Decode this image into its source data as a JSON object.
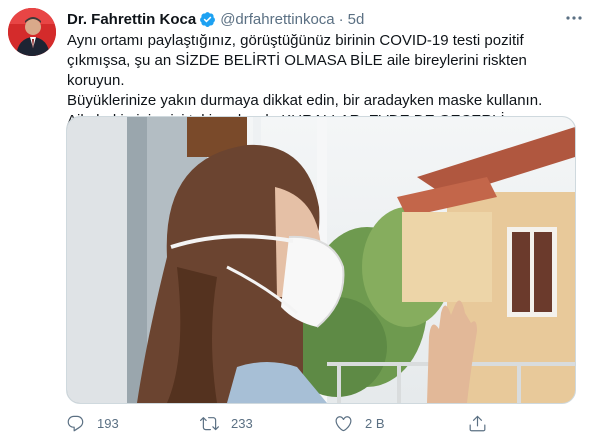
{
  "tweet": {
    "author_name": "Dr. Fahrettin Koca",
    "handle": "@drfahrettinkoca",
    "separator": "·",
    "time": "5d",
    "text": "Aynı ortamı paylaştığınız, görüştüğünüz birinin COVID-19 testi pozitif\nçıkmışsa, şu an SİZDE BELİRTİ OLMASA BİLE aile bireylerini riskten koruyun.\nBüyüklerinize yakın durmaya dikkat edin, bir aradayken maske kullanın.\nAile hekiminiz sizi takip edecek. KURALLAR, EVDE DE GEÇERLİ."
  },
  "actions": {
    "reply_count": "193",
    "retweet_count": "233",
    "like_count": "2 B"
  },
  "icons": {
    "verified": "verified-badge-icon",
    "more": "more-options-icon",
    "reply": "reply-icon",
    "retweet": "retweet-icon",
    "like": "like-icon",
    "share": "share-icon"
  },
  "colors": {
    "verified_blue": "#1da1f2",
    "secondary_text": "#5b7083"
  }
}
